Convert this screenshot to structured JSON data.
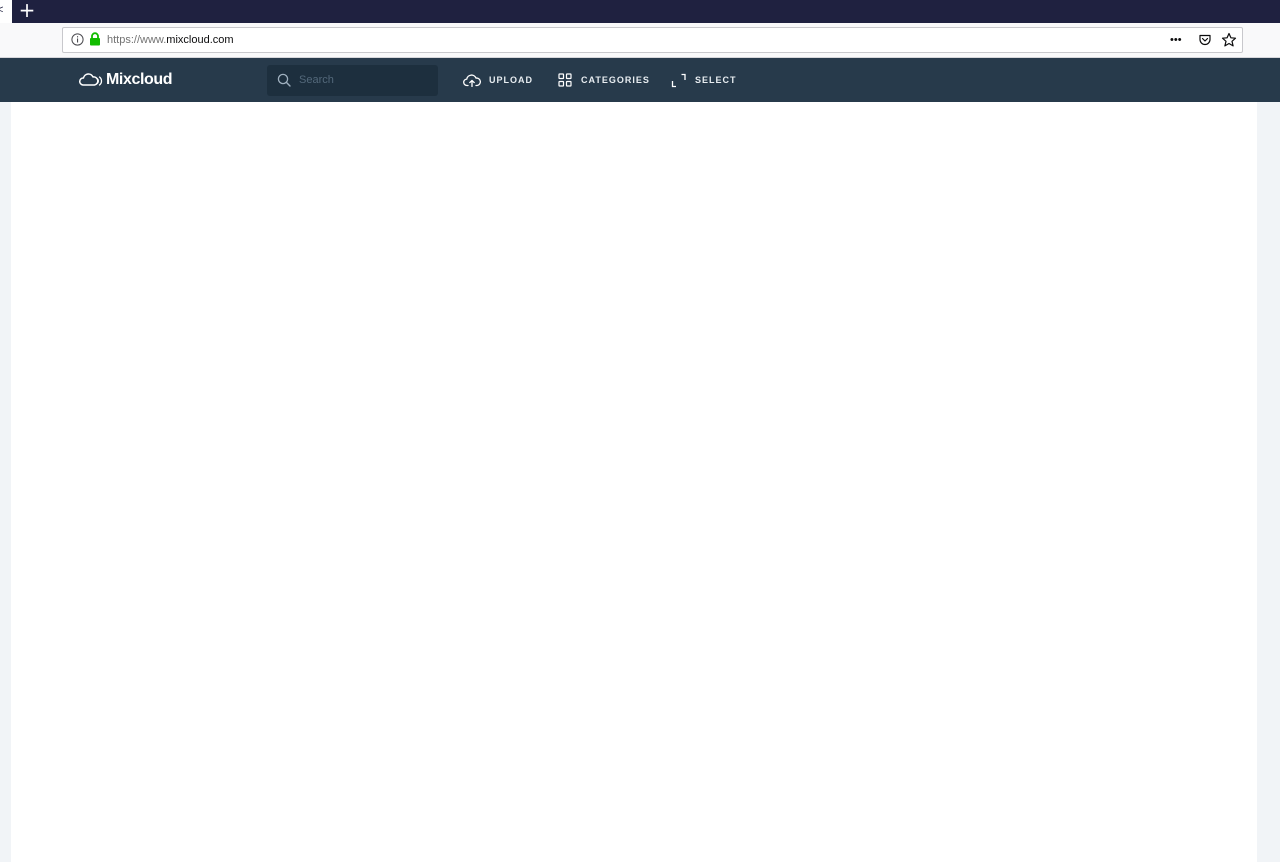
{
  "browser": {
    "tab_stub_glyph": "<",
    "new_tab_glyph": "+",
    "url": {
      "scheme": "https://www.",
      "domain": "mixcloud.com"
    },
    "page_actions_glyph": "•••"
  },
  "site": {
    "logo_text": "Mixcloud",
    "search": {
      "placeholder": "Search",
      "value": ""
    },
    "nav": {
      "upload": "UPLOAD",
      "categories": "CATEGORIES",
      "select": "SELECT"
    }
  },
  "colors": {
    "tab_strip": "#1f2140",
    "header": "#273a4b",
    "search_box": "#1d2f3e",
    "lock_green": "#12bc00"
  }
}
